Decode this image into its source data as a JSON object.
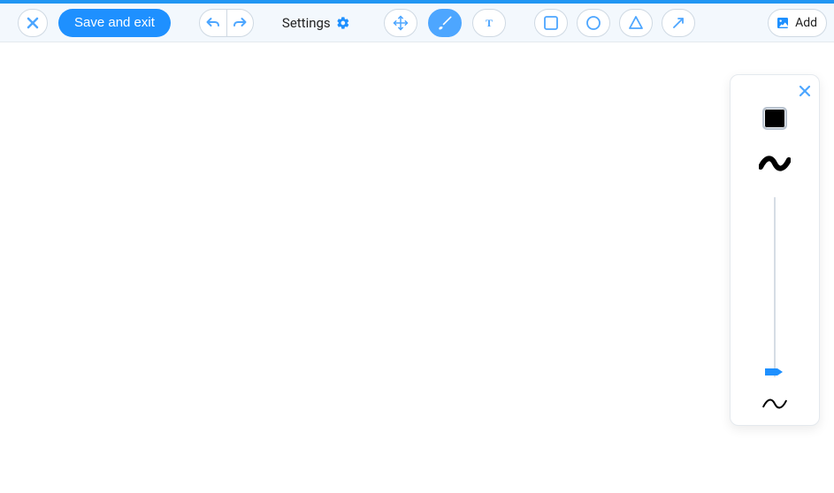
{
  "toolbar": {
    "save_label": "Save and exit",
    "settings_label": "Settings",
    "add_label": "Add"
  },
  "active_tool": "brush",
  "brush_panel": {
    "color": "#000000",
    "slider_value": 0
  }
}
